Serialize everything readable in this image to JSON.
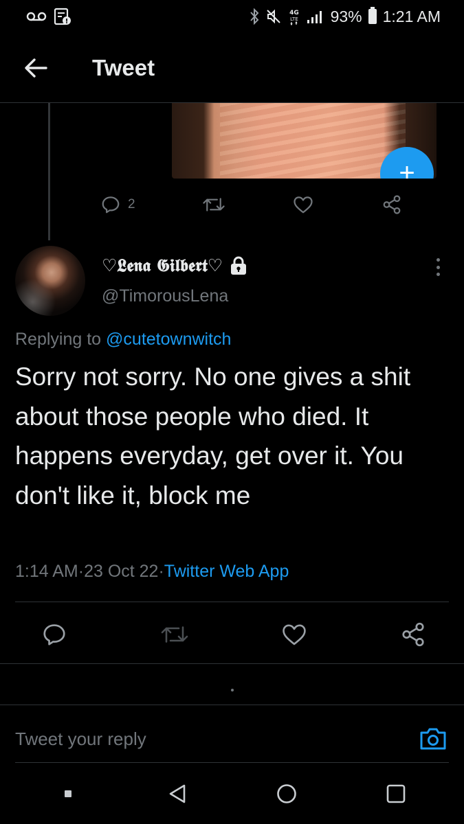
{
  "status_bar": {
    "battery": "93%",
    "time": "1:21 AM",
    "network": "4G LTE",
    "icons": [
      "voicemail-icon",
      "notification-icon",
      "bluetooth-icon",
      "mute-icon",
      "network-icon",
      "signal-icon",
      "battery-icon"
    ]
  },
  "header": {
    "title": "Tweet",
    "back_icon": "arrow-left-icon"
  },
  "previous_tweet": {
    "reply_count": "2",
    "actions": [
      "reply-icon",
      "retweet-icon",
      "like-icon",
      "share-icon"
    ]
  },
  "tweet": {
    "display_name": "♡𝕷𝖊𝖓𝖆 𝕲𝖎𝖑𝖇𝖊𝖗𝖙♡",
    "handle": "@TimorousLena",
    "protected": true,
    "replying_prefix": "Replying to ",
    "replying_to": "@cutetownwitch",
    "text": "Sorry not sorry. No one gives a shit about those people who died. It happens everyday, get over it. You don't like it, block me",
    "time": "1:14 AM",
    "separator": " · ",
    "date": "23 Oct 22",
    "source": "Twitter Web App"
  },
  "compose": {
    "fab_label": "+",
    "reply_placeholder": "Tweet your reply"
  },
  "colors": {
    "background": "#000000",
    "text": "#e7e9ea",
    "muted": "#71767b",
    "accent": "#1d9bf0",
    "divider": "#2f3336"
  }
}
